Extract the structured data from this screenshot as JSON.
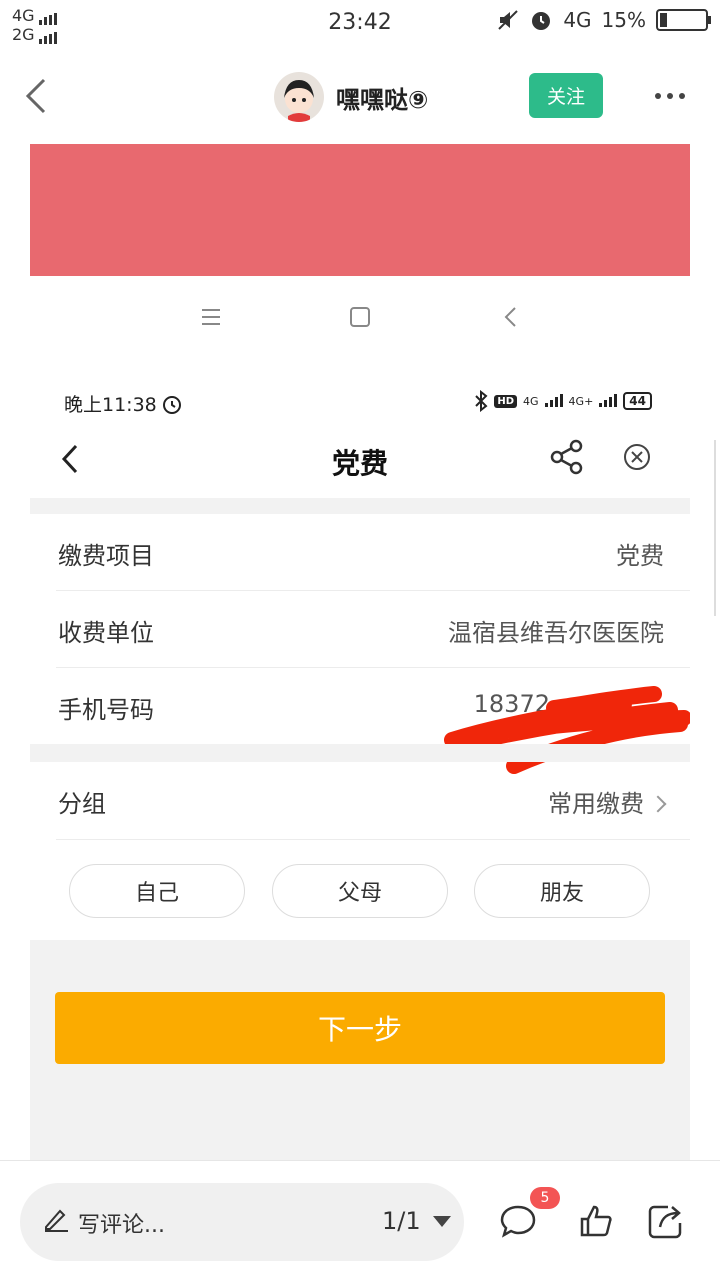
{
  "status_bar": {
    "net1": "4G",
    "net2": "2G",
    "time": "23:42",
    "network": "4G",
    "battery": "15%",
    "battery_level": 0.15
  },
  "nav": {
    "author_name": "嘿嘿哒⑨",
    "follow_label": "关注"
  },
  "inner": {
    "time": "晚上11:38",
    "hd": "HD",
    "net1": "4G",
    "net2": "4G+",
    "battery": "44",
    "title": "党费",
    "rows": [
      {
        "label": "缴费项目",
        "value": "党费"
      },
      {
        "label": "收费单位",
        "value": "温宿县维吾尔医医院"
      },
      {
        "label": "手机号码",
        "value": "18372"
      }
    ],
    "group": {
      "label": "分组",
      "value": "常用缴费"
    },
    "chips": [
      "自己",
      "父母",
      "朋友"
    ],
    "next_button": "下一步"
  },
  "bottom_bar": {
    "comment_placeholder": "写评论...",
    "pager": "1/1",
    "comment_count": "5"
  },
  "colors": {
    "accent_green": "#2dbb8a",
    "button_orange": "#fbab00",
    "red_band": "#e8696f",
    "badge_red": "#f35454"
  }
}
